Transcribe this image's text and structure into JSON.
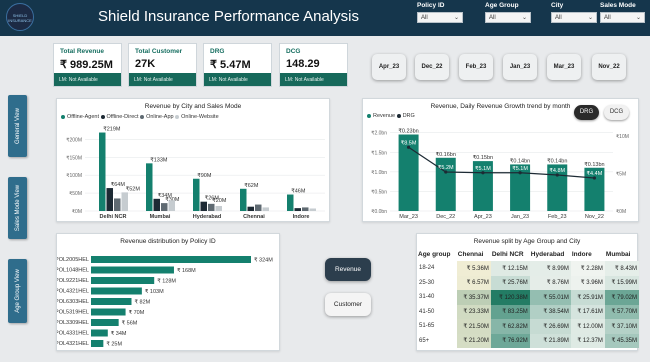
{
  "header": {
    "logo_text": "SHIELD INSURANCE",
    "title": "Shield Insurance Performance Analysis"
  },
  "filters": [
    {
      "label": "Policy ID",
      "value": "All"
    },
    {
      "label": "Age Group",
      "value": "All"
    },
    {
      "label": "City",
      "value": "All"
    },
    {
      "label": "Sales Mode",
      "value": "All"
    }
  ],
  "nav": [
    "General View",
    "Sales Mode View",
    "Age Group View"
  ],
  "kpis": [
    {
      "label": "Total Revenue",
      "value": "₹ 989.25M",
      "footer": "LM: Not Available"
    },
    {
      "label": "Total Customer",
      "value": "27K",
      "footer": "LM: Not Available"
    },
    {
      "label": "DRG",
      "value": "₹ 5.47M",
      "footer": "LM: Not Available"
    },
    {
      "label": "DCG",
      "value": "148.29",
      "footer": "LM: Not Available"
    }
  ],
  "month_buttons": [
    "Apr_23",
    "Dec_22",
    "Feb_23",
    "Jan_23",
    "Mar_23",
    "Nov_22"
  ],
  "city_chart": {
    "title": "Revenue by City and Sales Mode",
    "legend": [
      {
        "name": "Offline-Agent",
        "color": "#14806e"
      },
      {
        "name": "Offline-Direct",
        "color": "#1d2a34"
      },
      {
        "name": "Online-App",
        "color": "#5f6a72"
      },
      {
        "name": "Online-Website",
        "color": "#c6ccd0"
      }
    ],
    "y_ticks": [
      "₹0M",
      "₹50M",
      "₹100M",
      "₹150M",
      "₹200M"
    ],
    "cities": [
      "Delhi NCR",
      "Mumbai",
      "Hyderabad",
      "Chennai",
      "Indore"
    ],
    "labels": [
      [
        "₹219M",
        "₹64M",
        "",
        "₹52M"
      ],
      [
        "₹133M",
        "₹34M",
        "₹30M",
        ""
      ],
      [
        "₹90M",
        "₹26M",
        "₹20M",
        ""
      ],
      [
        "₹62M",
        "",
        "",
        ""
      ],
      [
        "₹46M",
        "",
        "",
        ""
      ]
    ]
  },
  "trend_chart": {
    "title": "Revenue, Daily Revenue Growth trend by month",
    "legend": [
      "Revenue",
      "DRG"
    ],
    "buttons": [
      "DRG",
      "DCG"
    ],
    "y_left": [
      "₹0.0bn",
      "₹0.5bn",
      "₹1.0bn",
      "₹1.5bn",
      "₹2.0bn"
    ],
    "y_right": [
      "₹0M",
      "₹5M",
      "₹10M"
    ],
    "months": [
      "Mar_23",
      "Dec_22",
      "Apr_23",
      "Jan_23",
      "Feb_23",
      "Nov_22"
    ],
    "revenue_labels": [
      "₹0.23bn",
      "₹0.16bn",
      "₹0.15bn",
      "₹0.14bn",
      "₹0.14bn",
      "₹0.13bn"
    ],
    "drg_labels": [
      "₹8.5M",
      "₹5.2M",
      "₹5.1M",
      "₹5.1M",
      "₹4.8M",
      "₹4.4M"
    ]
  },
  "policy_chart": {
    "title": "Revenue distribution by Policy ID",
    "policies": [
      "POL2005HEL",
      "POL1048HEL",
      "POL9221HEL",
      "POL4321HEL",
      "POL6303HEL",
      "POL5319HEL",
      "POL3309HEL",
      "POL4331HEL",
      "POL4321HEL"
    ],
    "labels": [
      "₹ 324M",
      "₹ 168M",
      "₹ 128M",
      "₹ 103M",
      "₹ 82M",
      "₹ 70M",
      "₹ 56M",
      "₹ 34M",
      "₹ 25M"
    ]
  },
  "action_buttons": [
    "Revenue",
    "Customer"
  ],
  "age_table": {
    "title": "Revenue split by Age Group and City",
    "headers": [
      "Age group",
      "Chennai",
      "Delhi NCR",
      "Hyderabad",
      "Indore",
      "Mumbai"
    ],
    "rows": [
      [
        "18-24",
        "₹ 5.36M",
        "₹ 12.15M",
        "₹ 8.99M",
        "₹ 2.28M",
        "₹ 8.43M"
      ],
      [
        "25-30",
        "₹ 6.57M",
        "₹ 25.76M",
        "₹ 8.76M",
        "₹ 3.96M",
        "₹ 15.99M"
      ],
      [
        "31-40",
        "₹ 35.37M",
        "₹ 120.38M",
        "₹ 55.01M",
        "₹ 25.91M",
        "₹ 79.02M"
      ],
      [
        "41-50",
        "₹ 23.33M",
        "₹ 83.25M",
        "₹ 38.54M",
        "₹ 17.61M",
        "₹ 57.70M"
      ],
      [
        "51-65",
        "₹ 21.50M",
        "₹ 62.82M",
        "₹ 26.69M",
        "₹ 12.00M",
        "₹ 37.10M"
      ],
      [
        "65+",
        "₹ 21.20M",
        "₹ 76.92M",
        "₹ 21.89M",
        "₹ 12.37M",
        "₹ 45.35M"
      ]
    ]
  },
  "chart_data": [
    {
      "type": "bar",
      "title": "Revenue by City and Sales Mode",
      "categories": [
        "Delhi NCR",
        "Mumbai",
        "Hyderabad",
        "Chennai",
        "Indore"
      ],
      "series": [
        {
          "name": "Offline-Agent",
          "values": [
            219,
            133,
            90,
            62,
            46
          ]
        },
        {
          "name": "Offline-Direct",
          "values": [
            64,
            34,
            26,
            12,
            8
          ]
        },
        {
          "name": "Online-App",
          "values": [
            35,
            22,
            20,
            18,
            10
          ]
        },
        {
          "name": "Online-Website",
          "values": [
            52,
            30,
            14,
            10,
            7
          ]
        }
      ],
      "ylim": [
        0,
        240
      ],
      "legend": "top-left"
    },
    {
      "type": "bar",
      "title": "Revenue, Daily Revenue Growth trend by month",
      "categories": [
        "Mar_23",
        "Dec_22",
        "Apr_23",
        "Jan_23",
        "Feb_23",
        "Nov_22"
      ],
      "series": [
        {
          "name": "Revenue",
          "values": [
            0.23,
            0.16,
            0.15,
            0.14,
            0.14,
            0.13
          ]
        },
        {
          "name": "DRG",
          "values": [
            8.5,
            5.2,
            5.1,
            5.1,
            4.8,
            4.4
          ]
        }
      ],
      "ylim": [
        0,
        2.3
      ],
      "y2lim": [
        0,
        12
      ],
      "legend": "top-left"
    },
    {
      "type": "bar",
      "title": "Revenue distribution by Policy ID",
      "categories": [
        "POL2005HEL",
        "POL1048HEL",
        "POL9221HEL",
        "POL4321HEL",
        "POL6303HEL",
        "POL5319HEL",
        "POL3309HEL",
        "POL4331HEL",
        "POL4321HEL"
      ],
      "values": [
        324,
        168,
        128,
        103,
        82,
        70,
        56,
        34,
        25
      ]
    }
  ],
  "colors": {
    "header": "#15364c",
    "accent": "#17695b",
    "nav": "#2f6d8c"
  }
}
